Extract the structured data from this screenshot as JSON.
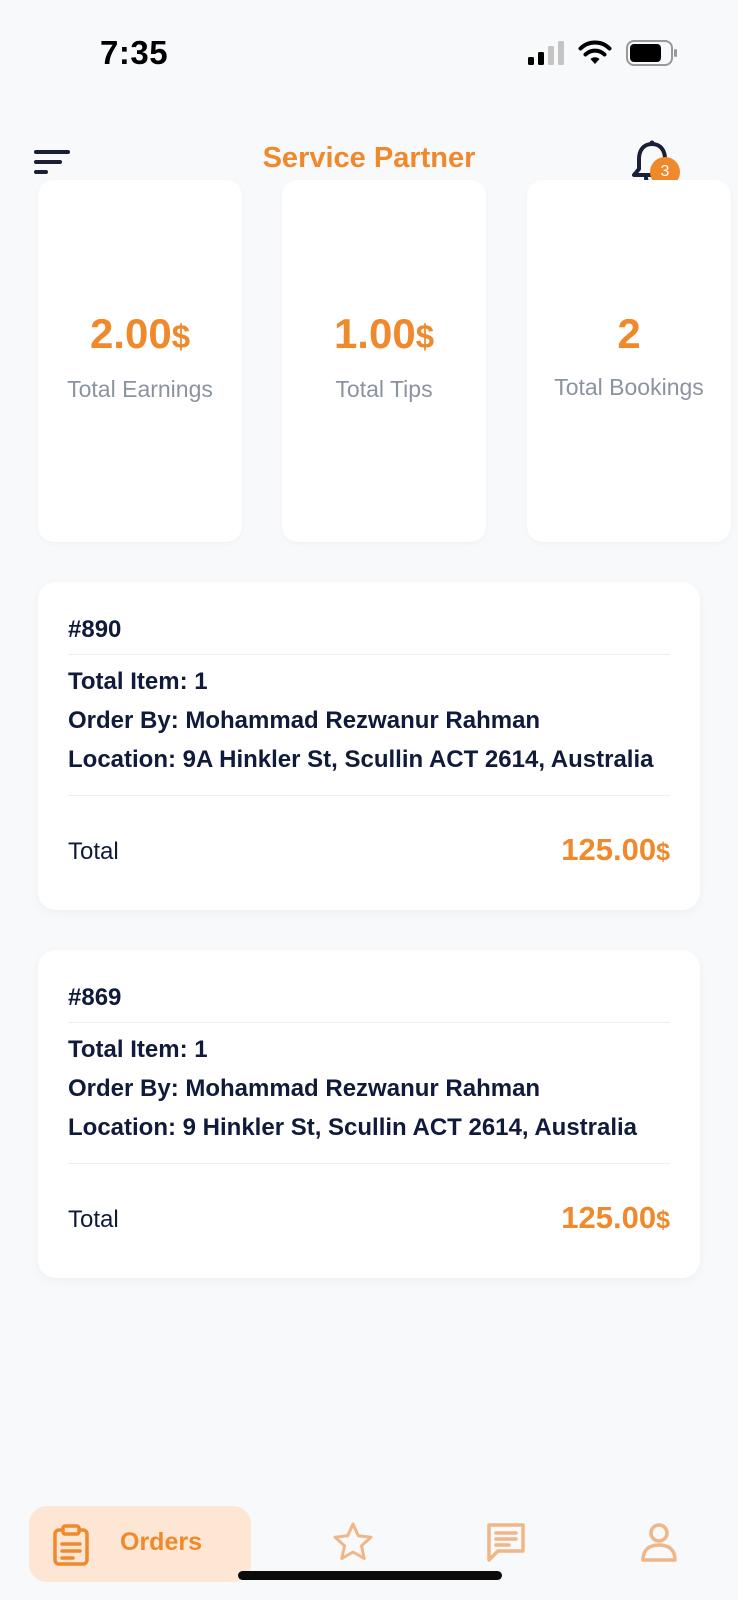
{
  "status_bar": {
    "time": "7:35"
  },
  "header": {
    "title": "Service Partner",
    "notification_count": "3"
  },
  "stats": [
    {
      "value": "2.00",
      "currency": "$",
      "label": "Total Earnings"
    },
    {
      "value": "1.00",
      "currency": "$",
      "label": "Total Tips"
    },
    {
      "value": "2",
      "currency": "",
      "label": "Total Bookings"
    }
  ],
  "orders": [
    {
      "id": "#890",
      "total_item": "Total Item: 1",
      "order_by": "Order By: Mohammad Rezwanur Rahman",
      "location": "Location: 9A Hinkler St, Scullin ACT 2614, Australia",
      "total_label": "Total",
      "total_value": "125.00",
      "currency": "$"
    },
    {
      "id": "#869",
      "total_item": "Total Item: 1",
      "order_by": "Order By: Mohammad Rezwanur Rahman",
      "location": "Location: 9 Hinkler St, Scullin ACT 2614, Australia",
      "total_label": "Total",
      "total_value": "125.00",
      "currency": "$"
    }
  ],
  "bottom_nav": {
    "items": [
      {
        "label": "Orders",
        "icon": "clipboard-icon",
        "active": true
      },
      {
        "label": "",
        "icon": "star-icon",
        "active": false
      },
      {
        "label": "",
        "icon": "chat-icon",
        "active": false
      },
      {
        "label": "",
        "icon": "profile-icon",
        "active": false
      }
    ]
  },
  "colors": {
    "accent": "#f0882c",
    "accent_light": "#fde6d3",
    "text_dark": "#101a3a",
    "text_muted": "#8b93a1",
    "background": "#f8f9fa"
  }
}
